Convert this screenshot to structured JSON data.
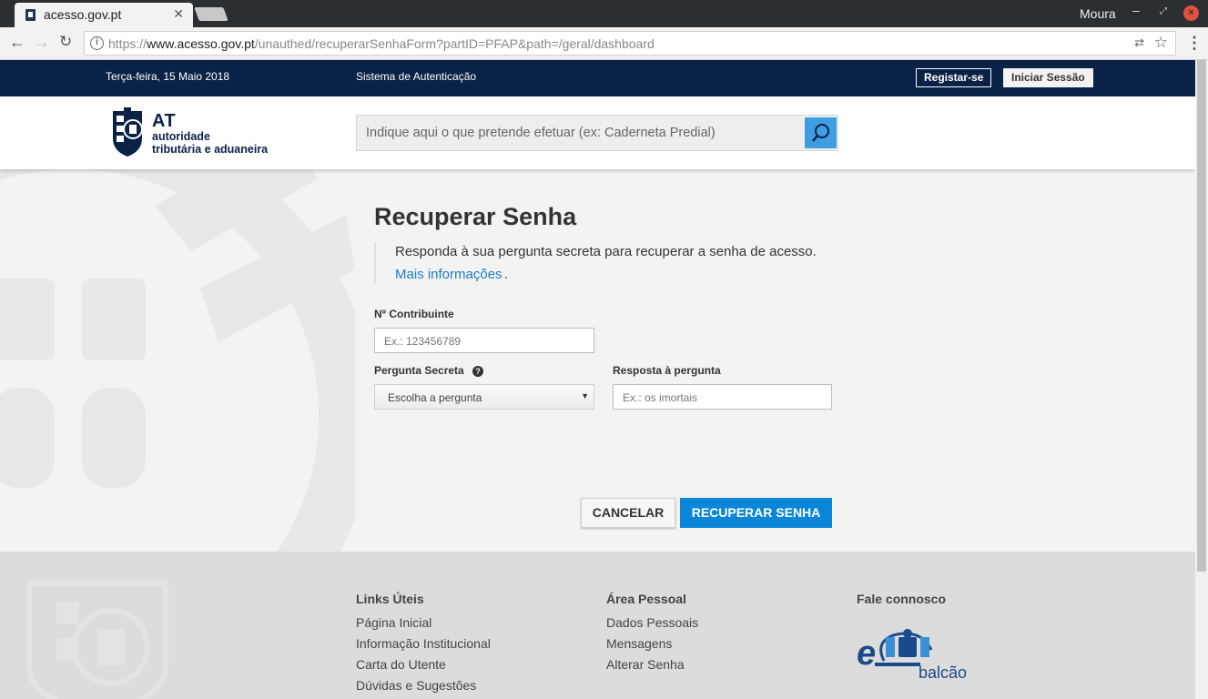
{
  "browser": {
    "tab_title": "acesso.gov.pt",
    "tab_close": "✕",
    "user": "Moura",
    "url_scheme": "https://",
    "url_host": "www.acesso.gov.pt",
    "url_path": "/unauthed/recuperarSenhaForm?partID=PFAP&path=/geral/dashboard"
  },
  "topbar": {
    "date": "Terça-feira, 15 Maio 2018",
    "system_name": "Sistema de Autenticação",
    "register_label": "Registar-se",
    "login_label": "Iniciar Sessão"
  },
  "logo": {
    "abbr": "AT",
    "line1": "autoridade",
    "line2": "tributária e aduaneira"
  },
  "search": {
    "placeholder": "Indique aqui o que pretende efetuar (ex: Caderneta Predial)"
  },
  "form": {
    "title": "Recuperar Senha",
    "intro": "Responda à sua pergunta secreta para recuperar a senha de acesso.",
    "more_info_link": "Mais informações",
    "more_info_suffix": ".",
    "nif_label": "Nº Contribuinte",
    "nif_placeholder": "Ex.: 123456789",
    "question_label": "Pergunta Secreta",
    "question_selected": "Escolha a pergunta",
    "answer_label": "Resposta à pergunta",
    "answer_placeholder": "Ex.: os imortais",
    "cancel_label": "CANCELAR",
    "submit_label": "RECUPERAR SENHA"
  },
  "footer": {
    "col1": {
      "title": "Links Úteis",
      "links": [
        "Página Inicial",
        "Informação Institucional",
        "Carta do Utente",
        "Dúvidas e Sugestões"
      ]
    },
    "col2": {
      "title": "Área Pessoal",
      "links": [
        "Dados Pessoais",
        "Mensagens",
        "Alterar Senha"
      ]
    },
    "col3": {
      "title": "Fale connosco",
      "ebalcao_e": "e",
      "ebalcao_text": "balcão"
    }
  },
  "colors": {
    "topbar_bg": "#0b2247",
    "primary_button": "#0a86d8",
    "search_button": "#3e9ee2",
    "link": "#1a7bbf"
  },
  "icons": [
    "back-icon",
    "forward-icon",
    "reload-icon",
    "info-icon",
    "translate-icon",
    "star-icon",
    "menu-icon",
    "search-icon",
    "help-icon",
    "chevron-down-icon"
  ]
}
